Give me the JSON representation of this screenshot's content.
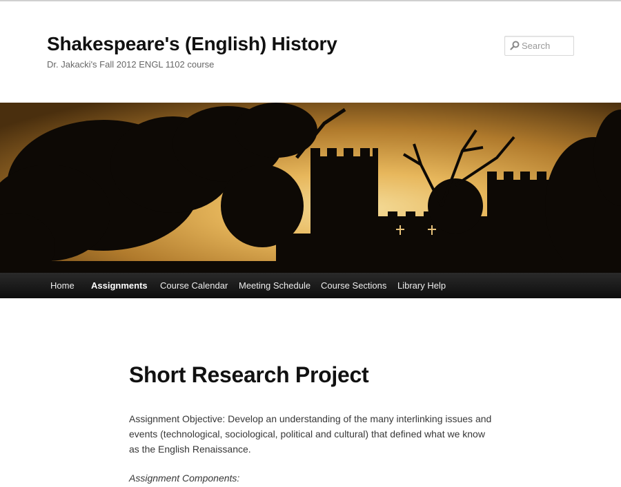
{
  "header": {
    "title": "Shakespeare's (English) History",
    "description": "Dr. Jakacki's Fall 2012 ENGL 1102 course"
  },
  "search": {
    "placeholder": "Search",
    "icon": "search-icon"
  },
  "banner": {
    "icon": "castle-silhouette-image",
    "sky_colors": [
      "#f4dc9a",
      "#e7b75c",
      "#b07a2c",
      "#4a2f0e"
    ]
  },
  "nav": {
    "items": [
      {
        "label": "Home"
      },
      {
        "label": "Assignments",
        "active": true
      },
      {
        "label": "Course Calendar"
      },
      {
        "label": "Meeting Schedule"
      },
      {
        "label": "Course Sections"
      },
      {
        "label": "Library Help"
      }
    ]
  },
  "content": {
    "title": "Short Research Project",
    "objective": "Assignment Objective: Develop an understanding of the many interlinking issues and events (technological, sociological, political and cultural) that defined what we know as the English Renaissance.",
    "components_label": "Assignment Components:"
  }
}
